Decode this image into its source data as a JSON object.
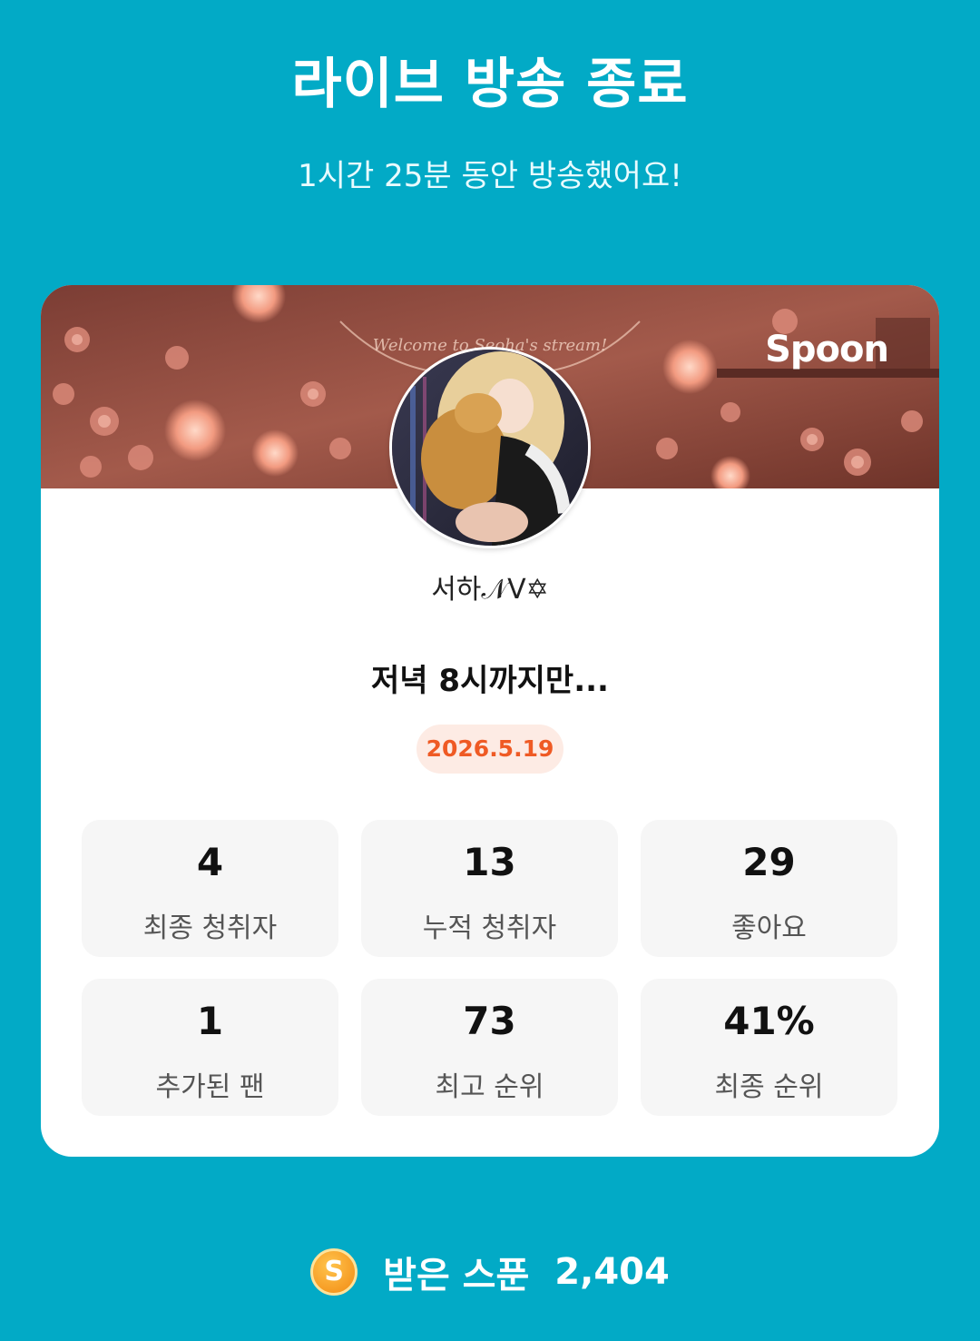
{
  "header": {
    "title": "라이브 방송 종료",
    "subtitle": "1시간 25분 동안 방송했어요!"
  },
  "card": {
    "brand_logo": "Spoon",
    "nickname": "서하𝒩V✡",
    "broadcast_title": "저녁 8시까지만...",
    "date": "2026.5.19",
    "stats": [
      {
        "value": "4",
        "label": "최종 청취자"
      },
      {
        "value": "13",
        "label": "누적 청취자"
      },
      {
        "value": "29",
        "label": "좋아요"
      },
      {
        "value": "1",
        "label": "추가된 팬"
      },
      {
        "value": "73",
        "label": "최고 순위"
      },
      {
        "value": "41%",
        "label": "최종 순위"
      }
    ]
  },
  "footer": {
    "coin_icon_letter": "S",
    "label": "받은 스푼",
    "value": "2,404"
  },
  "colors": {
    "background": "#02aac6",
    "date_text": "#ef5a24",
    "date_bg": "#fdebe4",
    "coin": "#f28a12"
  },
  "icons": {
    "coin": "spoon-coin-icon"
  }
}
